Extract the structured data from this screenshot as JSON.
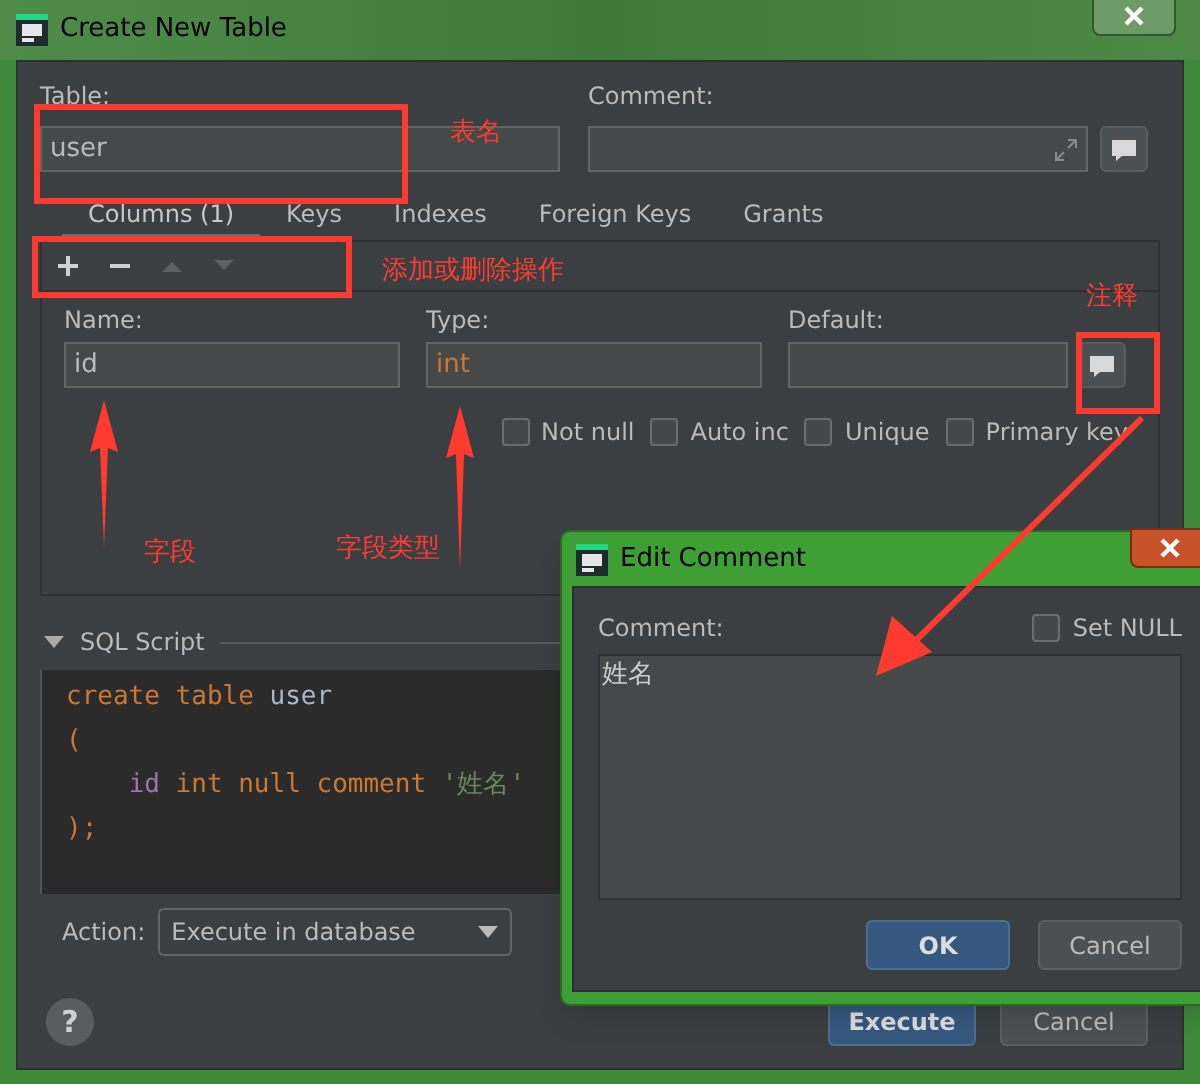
{
  "window": {
    "title": "Create New Table"
  },
  "table": {
    "label": "Table:",
    "value": "user"
  },
  "comment": {
    "label": "Comment:"
  },
  "tabs": [
    {
      "label": "Columns (1)",
      "selected": true
    },
    {
      "label": "Keys",
      "selected": false
    },
    {
      "label": "Indexes",
      "selected": false
    },
    {
      "label": "Foreign Keys",
      "selected": false
    },
    {
      "label": "Grants",
      "selected": false
    }
  ],
  "toolbar": [
    {
      "kind": "add",
      "disabled": false
    },
    {
      "kind": "remove",
      "disabled": false
    },
    {
      "kind": "up",
      "disabled": true
    },
    {
      "kind": "down",
      "disabled": true
    }
  ],
  "column": {
    "name_label": "Name:",
    "name": "id",
    "type_label": "Type:",
    "type": "int",
    "default_label": "Default:"
  },
  "options": [
    {
      "label": "Not null",
      "checked": false
    },
    {
      "label": "Auto inc",
      "checked": false
    },
    {
      "label": "Unique",
      "checked": false
    },
    {
      "label": "Primary key",
      "checked": false
    }
  ],
  "sql": {
    "title": "SQL Script",
    "expanded": true,
    "lines": [
      [
        {
          "kind": "keyword",
          "text": "create"
        },
        {
          "kind": "keyword",
          "text": "table"
        },
        {
          "kind": "identifier",
          "text": "user"
        }
      ],
      [
        {
          "kind": "punct",
          "text": "("
        }
      ],
      [
        {
          "kind": "indent"
        },
        {
          "kind": "column",
          "text": "id"
        },
        {
          "kind": "keyword",
          "text": "int"
        },
        {
          "kind": "keyword",
          "text": "null"
        },
        {
          "kind": "keyword",
          "text": "comment"
        },
        {
          "kind": "string",
          "text": "'姓名'"
        }
      ],
      [
        {
          "kind": "punct",
          "text": ");"
        }
      ]
    ]
  },
  "action": {
    "label": "Action:",
    "value": "Execute in database"
  },
  "help": "?",
  "buttons": [
    {
      "label": "Execute",
      "primary": true
    },
    {
      "label": "Cancel",
      "primary": false
    }
  ],
  "edit_comment": {
    "title": "Edit Comment",
    "label": "Comment:",
    "set_null": {
      "label": "Set NULL",
      "checked": false
    },
    "value": "姓名",
    "buttons": [
      {
        "label": "OK",
        "primary": true
      },
      {
        "label": "Cancel",
        "primary": false
      }
    ]
  },
  "annotations": [
    {
      "text": "表名"
    },
    {
      "text": "添加或删除操作"
    },
    {
      "text": "注释"
    },
    {
      "text": "字段"
    },
    {
      "text": "字段类型"
    }
  ]
}
